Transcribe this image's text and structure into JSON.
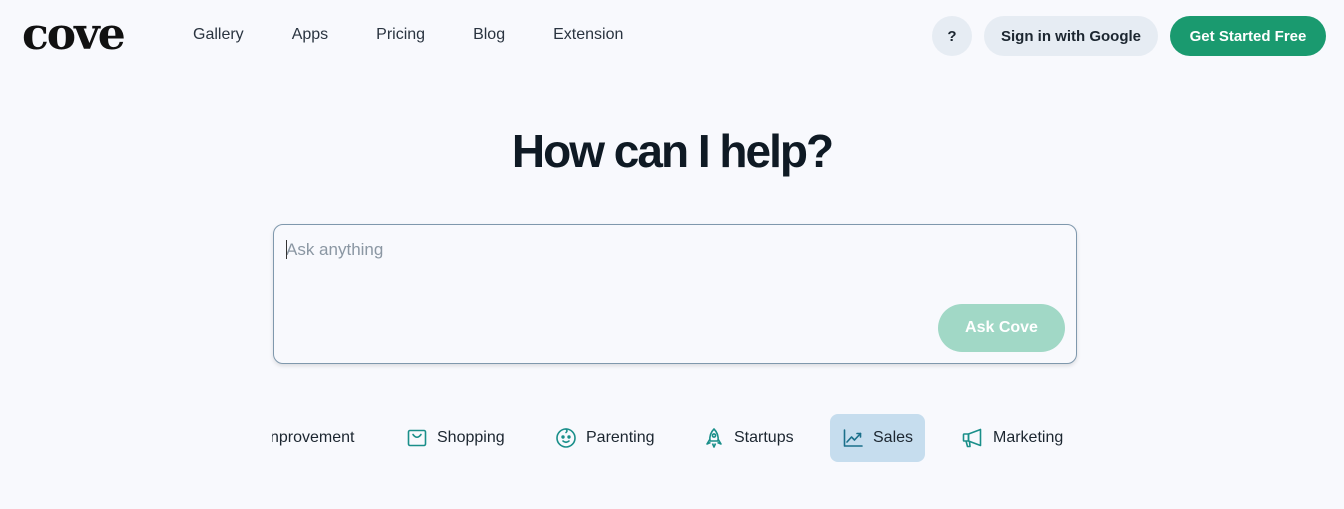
{
  "brand": {
    "logo_text": "cove"
  },
  "nav": {
    "items": [
      {
        "label": "Gallery"
      },
      {
        "label": "Apps"
      },
      {
        "label": "Pricing"
      },
      {
        "label": "Blog"
      },
      {
        "label": "Extension"
      }
    ]
  },
  "header": {
    "help_label": "?",
    "google_label": "Sign in with Google",
    "cta_label": "Get Started Free"
  },
  "main": {
    "headline": "How can I help?",
    "ask_placeholder": "Ask anything",
    "ask_value": "",
    "ask_button": "Ask Cove"
  },
  "categories": [
    {
      "label": "nprovement",
      "icon": "none"
    },
    {
      "label": "Shopping",
      "icon": "shopping-bag-icon"
    },
    {
      "label": "Parenting",
      "icon": "baby-face-icon"
    },
    {
      "label": "Startups",
      "icon": "rocket-icon"
    },
    {
      "label": "Sales",
      "icon": "trending-up-chart-icon",
      "active": true
    },
    {
      "label": "Marketing",
      "icon": "megaphone-icon"
    }
  ],
  "colors": {
    "accent": "#1a9a6f",
    "accent_disabled": "#a1d8c6",
    "icon_teal": "#1a8f8a",
    "active_chip": "#c6ddee",
    "background": "#f8f9fd"
  }
}
